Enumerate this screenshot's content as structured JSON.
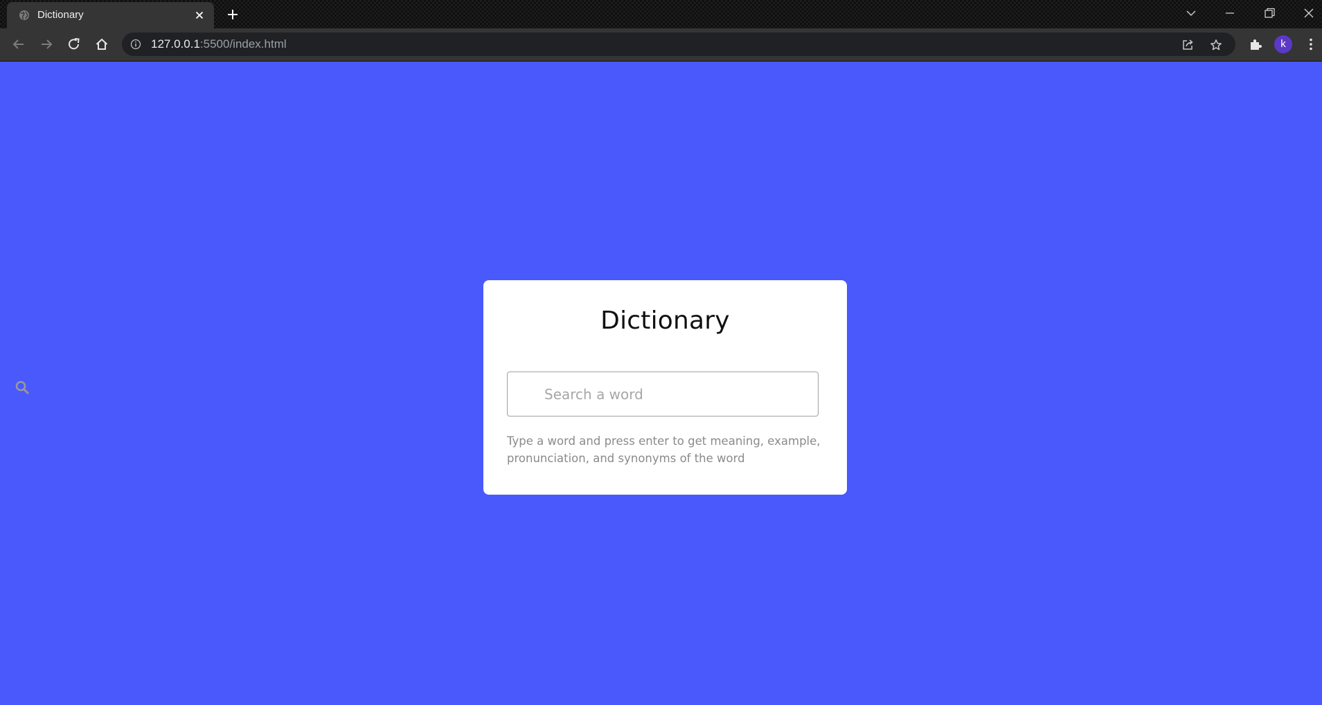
{
  "browser": {
    "tab_title": "Dictionary",
    "url_host": "127.0.0.1",
    "url_rest": ":5500/index.html",
    "profile_initial": "k",
    "icons": [
      "globe-icon",
      "close-icon",
      "plus-icon",
      "chevron-down-icon",
      "minimize-icon",
      "restore-icon",
      "close-window-icon",
      "back-icon",
      "forward-icon",
      "reload-icon",
      "home-icon",
      "info-icon",
      "share-icon",
      "star-icon",
      "puzzle-icon",
      "kebab-menu-icon"
    ]
  },
  "page": {
    "background_color": "#4a59fc",
    "card": {
      "title": "Dictionary",
      "search_placeholder": "Search a word",
      "search_value": "",
      "hint": "Type a word and press enter to get meaning, example, pronunciation, and synonyms of the word"
    },
    "stray_icon": "search-icon"
  }
}
